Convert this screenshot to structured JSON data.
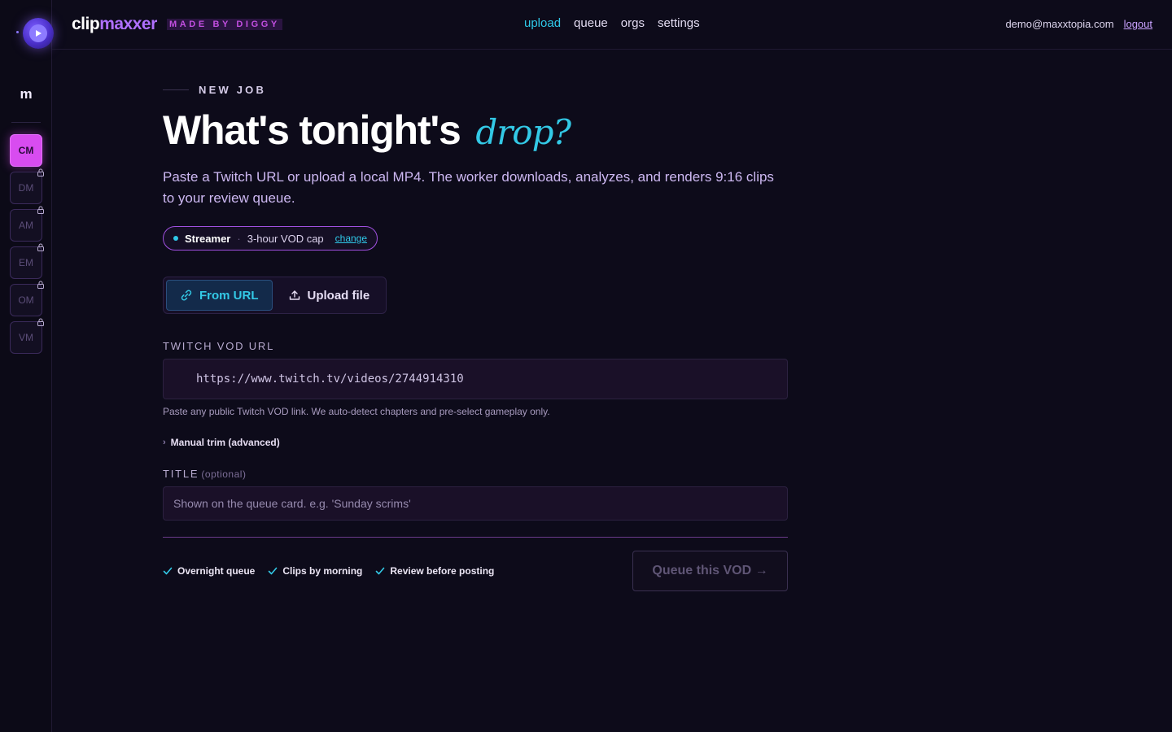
{
  "app": {
    "brand_part1": "clip",
    "brand_part2": "maxxer",
    "made_by": "MADE BY DIGGY"
  },
  "nav": {
    "items": [
      {
        "label": "upload",
        "current": true
      },
      {
        "label": "queue",
        "current": false
      },
      {
        "label": "orgs",
        "current": false
      },
      {
        "label": "settings",
        "current": false
      }
    ]
  },
  "account": {
    "email": "demo@maxxtopia.com",
    "logout": "logout"
  },
  "rail": {
    "initial": "m",
    "orgs": [
      {
        "label": "CM",
        "active": true,
        "locked": false
      },
      {
        "label": "DM",
        "active": false,
        "locked": true
      },
      {
        "label": "AM",
        "active": false,
        "locked": true
      },
      {
        "label": "EM",
        "active": false,
        "locked": true
      },
      {
        "label": "OM",
        "active": false,
        "locked": true
      },
      {
        "label": "VM",
        "active": false,
        "locked": true
      }
    ]
  },
  "job": {
    "eyebrow": "NEW JOB",
    "headline": "What's tonight's",
    "headline_accent": "drop?",
    "lede": "Paste a Twitch URL or upload a local MP4. The worker downloads, analyzes, and renders 9:16 clips to your review queue.",
    "plan": {
      "tier": "Streamer",
      "separator": "·",
      "cap": "3-hour VOD cap",
      "change": "change"
    },
    "source_tabs": [
      {
        "label": "From URL",
        "icon": "link-icon",
        "active": true
      },
      {
        "label": "Upload file",
        "icon": "upload-icon",
        "active": false
      }
    ],
    "url_field": {
      "label": "TWITCH VOD URL",
      "value": "https://www.twitch.tv/videos/2744914310",
      "helper": "Paste any public Twitch VOD link. We auto-detect chapters and pre-select gameplay only."
    },
    "manual_trim": "Manual trim (advanced)",
    "title_field": {
      "label": "TITLE",
      "optional": "(optional)",
      "placeholder": "Shown on the queue card. e.g. 'Sunday scrims'"
    },
    "checks": [
      "Overnight queue",
      "Clips by morning",
      "Review before posting"
    ],
    "submit": "Queue this VOD →"
  },
  "colors": {
    "background": "#0d0b1a",
    "accent_cyan": "#33c9e6",
    "accent_magenta": "#d84cf0",
    "brand_purple": "#b070ff"
  }
}
